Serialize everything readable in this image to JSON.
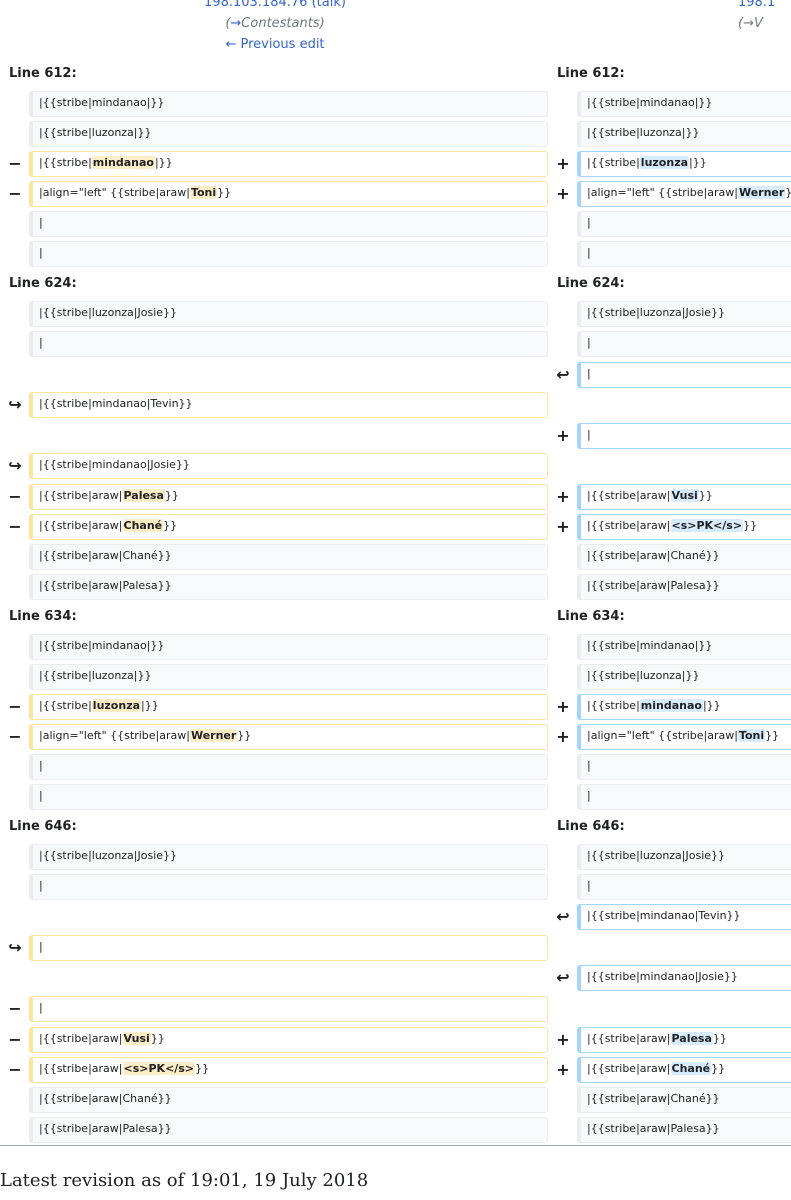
{
  "header": {
    "left_ip": "198.103.184.76",
    "left_talk": "talk",
    "left_comment_arrow": "→",
    "left_comment": "Contestants",
    "previous_edit": "← Previous edit",
    "right_ip": "198.1",
    "right_comment": "(→V"
  },
  "sections": [
    {
      "label_left": "Line 612:",
      "label_right": "Line 612:"
    },
    {
      "label_left": "Line 624:",
      "label_right": "Line 624:"
    },
    {
      "label_left": "Line 634:",
      "label_right": "Line 634:"
    },
    {
      "label_left": "Line 646:",
      "label_right": "Line 646:"
    }
  ],
  "markers": {
    "del": "−",
    "add": "+",
    "moved_out": "↪",
    "moved_in": "↩"
  },
  "rows": [
    {
      "l": "|{{stribe|mindanao|}}",
      "r": "|{{stribe|mindanao|}}"
    },
    {
      "l": "|{{stribe|luzonza|}}",
      "r": "|{{stribe|luzonza|}}"
    },
    {
      "l_pre": "|{{stribe|",
      "l_hl": "mindanao",
      "l_post": "|}}",
      "r_pre": "|{{stribe|",
      "r_hl": "luzonza",
      "r_post": "|}}"
    },
    {
      "l_pre": "|align=\"left\" {{stribe|araw|",
      "l_hl": "Toni",
      "l_post": "}}",
      "r_pre": "|align=\"left\" {{stribe|araw|",
      "r_hl": "Werner",
      "r_post": "}}"
    },
    {
      "l": "|",
      "r": "|"
    },
    {
      "l": "|",
      "r": "|"
    },
    {
      "l": "|{{stribe|luzonza|Josie}}",
      "r": "|{{stribe|luzonza|Josie}}"
    },
    {
      "l": "|",
      "r": "|"
    },
    {
      "r": "|"
    },
    {
      "l": "|{{stribe|mindanao|Tevin}}"
    },
    {
      "r": "|"
    },
    {
      "l": "|{{stribe|mindanao|Josie}}"
    },
    {
      "l_pre": "|{{stribe|araw|",
      "l_hl": "Palesa",
      "l_post": "}}",
      "r_pre": "|{{stribe|araw|",
      "r_hl": "Vusi",
      "r_post": "}}"
    },
    {
      "l_pre": "|{{stribe|araw|",
      "l_hl": "Chané",
      "l_post": "}}",
      "r_pre": "|{{stribe|araw|",
      "r_hl": "<s>PK</s>",
      "r_post": "}}"
    },
    {
      "l": "|{{stribe|araw|Chané}}",
      "r": "|{{stribe|araw|Chané}}"
    },
    {
      "l": "|{{stribe|araw|Palesa}}",
      "r": "|{{stribe|araw|Palesa}}"
    },
    {
      "l": "|{{stribe|mindanao|}}",
      "r": "|{{stribe|mindanao|}}"
    },
    {
      "l": "|{{stribe|luzonza|}}",
      "r": "|{{stribe|luzonza|}}"
    },
    {
      "l_pre": "|{{stribe|",
      "l_hl": "luzonza",
      "l_post": "|}}",
      "r_pre": "|{{stribe|",
      "r_hl": "mindanao",
      "r_post": "|}}"
    },
    {
      "l_pre": "|align=\"left\" {{stribe|araw|",
      "l_hl": "Werner",
      "l_post": "}}",
      "r_pre": "|align=\"left\" {{stribe|araw|",
      "r_hl": "Toni",
      "r_post": "}}"
    },
    {
      "l": "|",
      "r": "|"
    },
    {
      "l": "|",
      "r": "|"
    },
    {
      "l": "|{{stribe|luzonza|Josie}}",
      "r": "|{{stribe|luzonza|Josie}}"
    },
    {
      "l": "|",
      "r": "|"
    },
    {
      "r": "|{{stribe|mindanao|Tevin}}"
    },
    {
      "l": "|"
    },
    {
      "r": "|{{stribe|mindanao|Josie}}"
    },
    {
      "l": "|"
    },
    {
      "l_pre": "|{{stribe|araw|",
      "l_hl": "Vusi",
      "l_post": "}}",
      "r_pre": "|{{stribe|araw|",
      "r_hl": "Palesa",
      "r_post": "}}"
    },
    {
      "l_pre": "|{{stribe|araw|",
      "l_hl": "<s>PK</s>",
      "l_post": "}}",
      "r_pre": "|{{stribe|araw|",
      "r_hl": "Chané",
      "r_post": "}}"
    },
    {
      "l": "|{{stribe|araw|Chané}}",
      "r": "|{{stribe|araw|Chané}}"
    },
    {
      "l": "|{{stribe|araw|Palesa}}",
      "r": "|{{stribe|araw|Palesa}}"
    }
  ],
  "footer": {
    "latest_revision": "Latest revision as of 19:01, 19 July 2018"
  }
}
